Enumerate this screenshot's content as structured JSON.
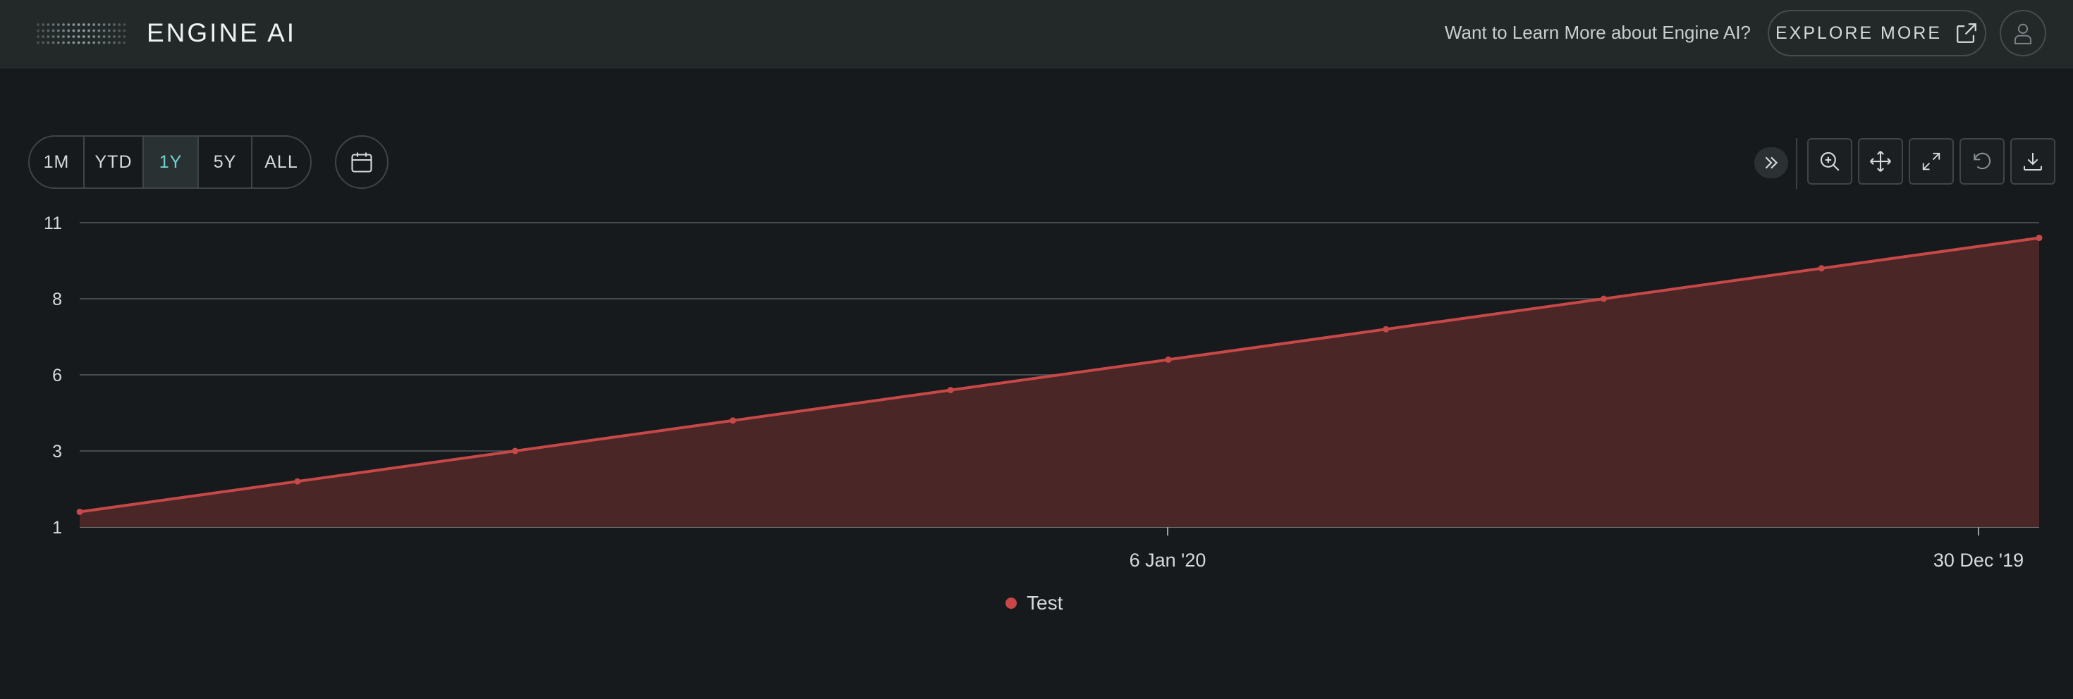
{
  "header": {
    "brand": "ENGINE AI",
    "promo_text": "Want to Learn More about Engine AI?",
    "explore_label": "EXPLORE MORE",
    "explore_icon": "external-link-icon",
    "avatar_icon": "user-icon"
  },
  "toolbar": {
    "ranges": [
      "1M",
      "YTD",
      "1Y",
      "5Y",
      "ALL"
    ],
    "active_range": "1Y",
    "calendar_icon": "calendar-icon",
    "tools": [
      "expand-icon",
      "zoom-in-icon",
      "pan-icon",
      "fullscreen-icon",
      "reset-icon",
      "download-icon"
    ]
  },
  "colors": {
    "accent": "#6fd4cd",
    "series": "#c84848",
    "background": "#161a1c",
    "header": "#232829"
  },
  "chart_data": {
    "type": "area",
    "y_tick_labels": [
      "1",
      "3",
      "6",
      "8",
      "11"
    ],
    "x_tick_labels": [
      "6 Jan '20",
      "30 Dec '19"
    ],
    "ylim": [
      1,
      11
    ],
    "grid": true,
    "legend_position": "bottom-center",
    "series": [
      {
        "name": "Test",
        "color": "#c84848",
        "values": [
          1.5,
          2.5,
          3.5,
          4.5,
          5.5,
          6.5,
          7.5,
          8.5,
          9.5,
          10.5
        ]
      }
    ]
  }
}
